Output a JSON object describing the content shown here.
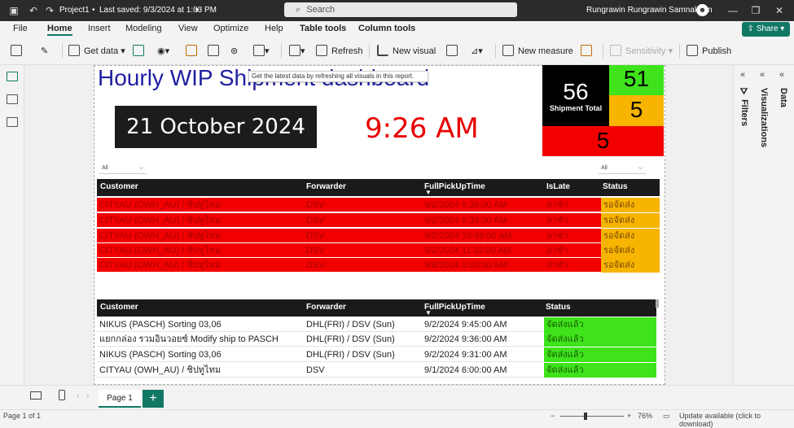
{
  "app": {
    "filename": "Project1",
    "saved": "Last saved: 9/3/2024 at 1:03 PM",
    "search_placeholder": "Search",
    "user": "Rungrawin Rungrawin Samnaknon",
    "user_initial": "☻"
  },
  "menu": [
    "File",
    "Home",
    "Insert",
    "Modeling",
    "View",
    "Optimize",
    "Help",
    "Table tools",
    "Column tools"
  ],
  "share": "Share",
  "ribbon": {
    "get_data": "Get data",
    "refresh": "Refresh",
    "new_visual": "New visual",
    "new_measure": "New measure",
    "sensitivity": "Sensitivity",
    "publish": "Publish"
  },
  "tooltip": "Get the latest data by refreshing all visuals in this report.",
  "dashboard": {
    "title": "Hourly WIP Shipment dashboard",
    "date": "21 October 2024",
    "time": "9:26 AM"
  },
  "kpi": {
    "total_value": "56",
    "total_label": "Shipment Total",
    "green_value": "51",
    "amber_value": "5",
    "red_value": "5"
  },
  "slicers": {
    "left": "All",
    "right": "All"
  },
  "table1": {
    "headers": [
      "Customer",
      "Forwarder",
      "FullPickUpTime",
      "IsLate",
      "Status"
    ],
    "rows": [
      [
        "CITYAU (OWH_AU) / ชิปทูไทม",
        "DSV",
        "9/2/2024 9:38:00 AM",
        "ล่าช้า",
        "รอจัดส่ง"
      ],
      [
        "CITYAU (OWH_AU) / ชิปทูไทม",
        "DSV",
        "9/2/2024 9:39:00 AM",
        "ล่าช้า",
        "รอจัดส่ง"
      ],
      [
        "CITYAU (OWH_AU) / ชิปทูไทม",
        "DSV",
        "9/2/2024 10:48:00 AM",
        "ล่าช้า",
        "รอจัดส่ง"
      ],
      [
        "CITYAU (OWH_AU) / ชิปทูไทม",
        "DSV",
        "9/2/2024 11:32:00 AM",
        "ล่าช้า",
        "รอจัดส่ง"
      ],
      [
        "CITYAU (OWH_AU) / ชิปทูไทม",
        "DSV",
        "9/8/2024 3:00:00 AM",
        "ล่าช้า",
        "รอจัดส่ง"
      ]
    ]
  },
  "table2": {
    "headers": [
      "Customer",
      "Forwarder",
      "FullPickUpTime",
      "Status"
    ],
    "rows": [
      [
        "NIKUS (PASCH) Sorting 03,06",
        "DHL(FRI) / DSV (Sun)",
        "9/2/2024 9:45:00 AM",
        "จัดส่งแล้ว"
      ],
      [
        "แยกกล่อง รวมอินวอยซ์ Modify ship to PASCH",
        "DHL(FRI) / DSV (Sun)",
        "9/2/2024 9:36:00 AM",
        "จัดส่งแล้ว"
      ],
      [
        "NIKUS (PASCH) Sorting 03,06",
        "DHL(FRI) / DSV (Sun)",
        "9/2/2024 9:31:00 AM",
        "จัดส่งแล้ว"
      ],
      [
        "CITYAU (OWH_AU) / ชิปทูไทม",
        "DSV",
        "9/1/2024 6:00:00 AM",
        "จัดส่งแล้ว"
      ]
    ]
  },
  "panels": {
    "filters": "Filters",
    "visualizations": "Visualizations",
    "data": "Data"
  },
  "pages": {
    "page1": "Page 1",
    "add": "+"
  },
  "status": {
    "page_info": "Page 1 of 1",
    "zoom": "76%",
    "update": "Update available (click to download)"
  }
}
